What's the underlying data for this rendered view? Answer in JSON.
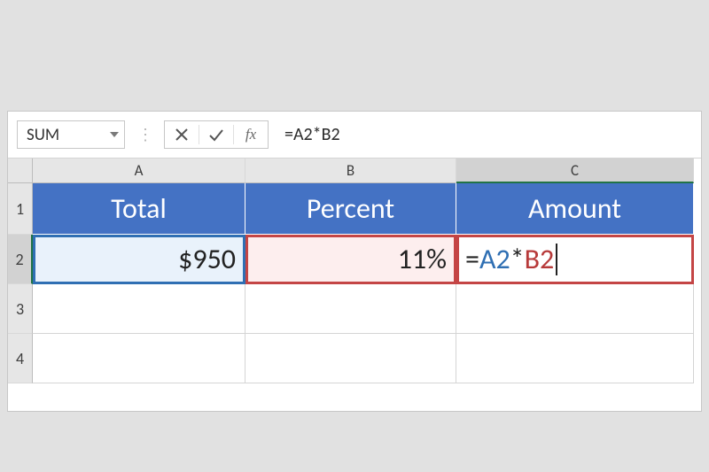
{
  "nameBox": {
    "value": "SUM"
  },
  "formulaBar": {
    "fx_label": "fx",
    "formula": "=A2*B2",
    "formula_parts": {
      "eq": "=",
      "ref1": "A2",
      "op": "*",
      "ref2": "B2"
    }
  },
  "columns": {
    "A": "A",
    "B": "B",
    "C": "C"
  },
  "rows": {
    "r1": "1",
    "r2": "2",
    "r3": "3",
    "r4": "4"
  },
  "header_row": {
    "A": "Total",
    "B": "Percent",
    "C": "Amount"
  },
  "data_row2": {
    "A": "$950",
    "B": "11%",
    "C_parts": {
      "eq": "=",
      "ref1": "A2",
      "op": "*",
      "ref2": "B2"
    }
  },
  "colors": {
    "header_bg": "#4472c4",
    "ref1_outline": "#2f6fb3",
    "ref2_outline": "#c44545"
  }
}
